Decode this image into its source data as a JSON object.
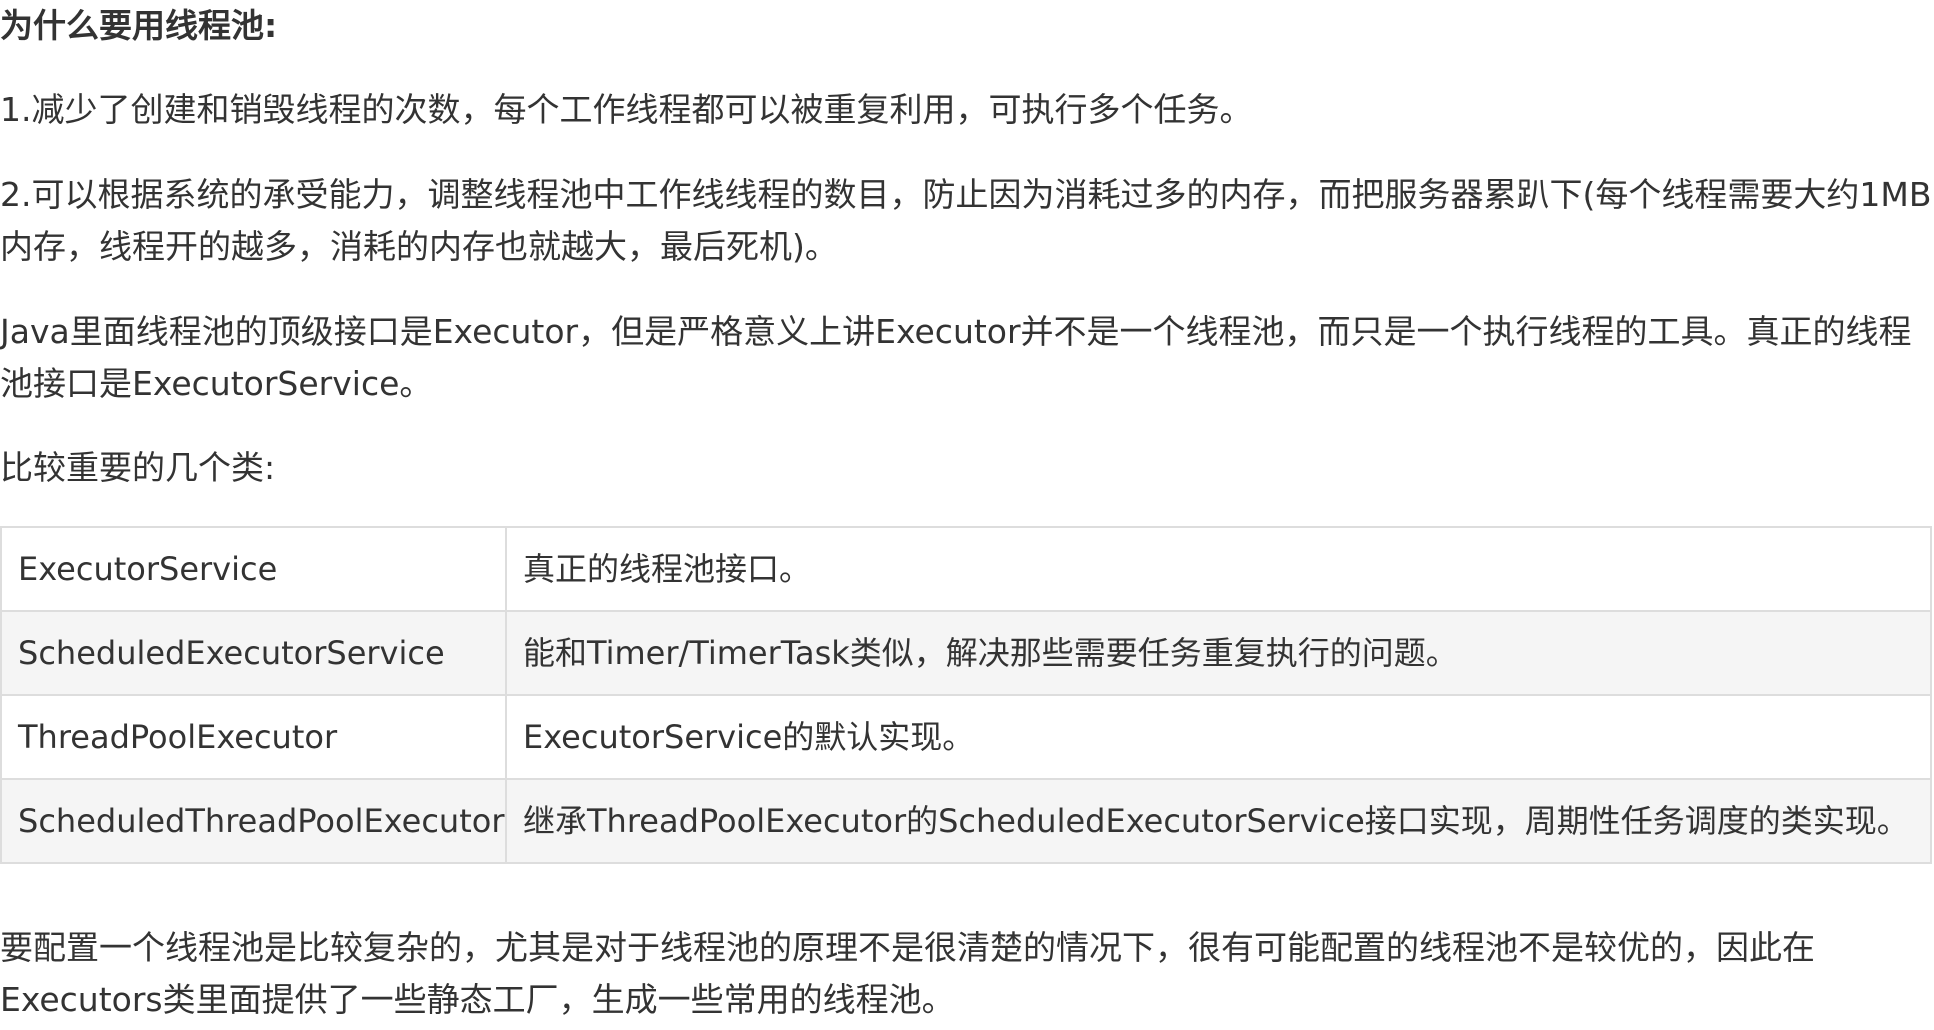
{
  "heading": "为什么要用线程池:",
  "paragraphs": {
    "p1": "1.减少了创建和销毁线程的次数，每个工作线程都可以被重复利用，可执行多个任务。",
    "p2": "2.可以根据系统的承受能力，调整线程池中工作线线程的数目，防止因为消耗过多的内存，而把服务器累趴下(每个线程需要大约1MB内存，线程开的越多，消耗的内存也就越大，最后死机)。",
    "p3": "Java里面线程池的顶级接口是Executor，但是严格意义上讲Executor并不是一个线程池，而只是一个执行线程的工具。真正的线程池接口是ExecutorService。",
    "p4": "比较重要的几个类:",
    "p5": "要配置一个线程池是比较复杂的，尤其是对于线程池的原理不是很清楚的情况下，很有可能配置的线程池不是较优的，因此在Executors类里面提供了一些静态工厂，生成一些常用的线程池。"
  },
  "table": {
    "rows": [
      {
        "name": "ExecutorService",
        "desc": "真正的线程池接口。"
      },
      {
        "name": "ScheduledExecutorService",
        "desc": "能和Timer/TimerTask类似，解决那些需要任务重复执行的问题。"
      },
      {
        "name": "ThreadPoolExecutor",
        "desc": "ExecutorService的默认实现。"
      },
      {
        "name": "ScheduledThreadPoolExecutor",
        "desc": "继承ThreadPoolExecutor的ScheduledExecutorService接口实现，周期性任务调度的类实现。"
      }
    ]
  }
}
